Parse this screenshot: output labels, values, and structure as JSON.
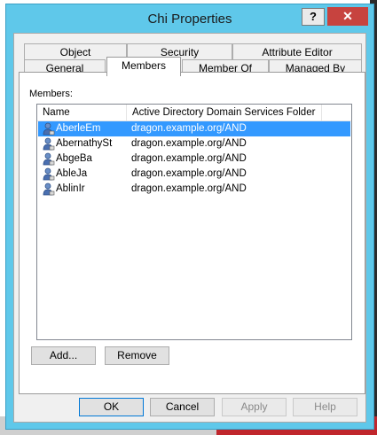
{
  "dialog": {
    "title": "Chi Properties"
  },
  "titlebar": {
    "help_label": "?",
    "close_label": "✕"
  },
  "tabs": {
    "row1": [
      {
        "label": "Object"
      },
      {
        "label": "Security"
      },
      {
        "label": "Attribute Editor"
      }
    ],
    "row2": [
      {
        "label": "General"
      },
      {
        "label": "Members"
      },
      {
        "label": "Member Of"
      },
      {
        "label": "Managed By"
      }
    ],
    "active": "Members"
  },
  "members": {
    "label": "Members:",
    "columns": [
      "Name",
      "Active Directory Domain Services Folder"
    ],
    "rows": [
      {
        "name": "AberleEm",
        "folder": "dragon.example.org/AND",
        "selected": true
      },
      {
        "name": "AbernathySt",
        "folder": "dragon.example.org/AND"
      },
      {
        "name": "AbgeBa",
        "folder": "dragon.example.org/AND"
      },
      {
        "name": "AbleJa",
        "folder": "dragon.example.org/AND"
      },
      {
        "name": "AblinIr",
        "folder": "dragon.example.org/AND"
      }
    ],
    "row_icon": "user-icon"
  },
  "actions": {
    "add_label": "Add...",
    "remove_label": "Remove"
  },
  "footer": {
    "ok_label": "OK",
    "cancel_label": "Cancel",
    "apply_label": "Apply",
    "help_label": "Help"
  },
  "colors": {
    "titlebar": "#5fc8ea",
    "selection": "#3399ff",
    "close": "#c7433f"
  }
}
